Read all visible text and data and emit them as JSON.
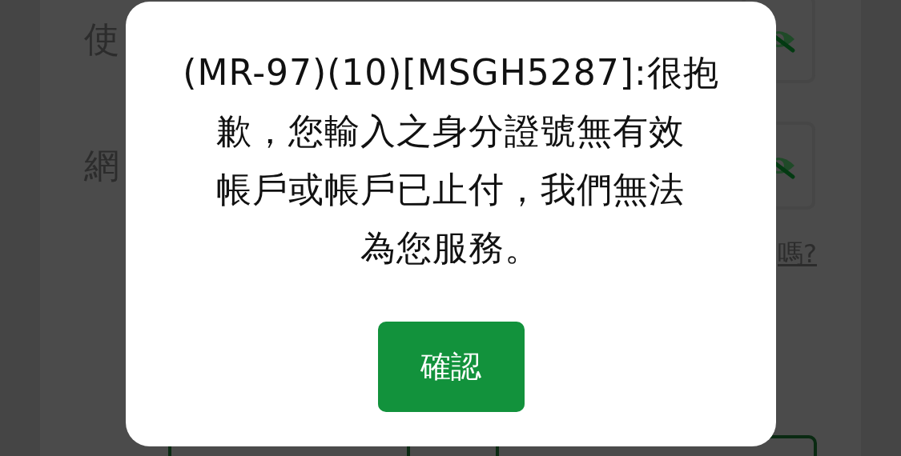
{
  "form": {
    "fields": [
      {
        "label": "使"
      },
      {
        "label": "網"
      }
    ],
    "link": "嗎?"
  },
  "dialog": {
    "message": [
      "(MR-97)(10)[MSGH5287]:很抱",
      "歉，您輸入之身分證號無有效",
      "帳戶或帳戶已止付，我們無法",
      "為您服務。"
    ],
    "confirm": "確認"
  }
}
